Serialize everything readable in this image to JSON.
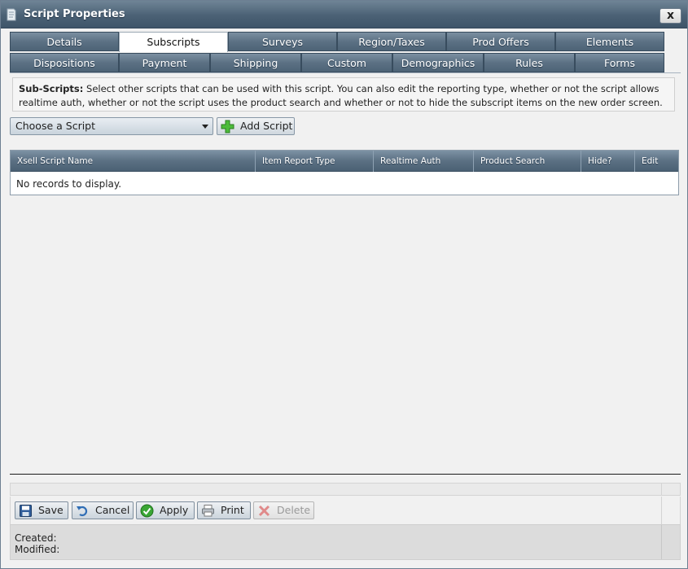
{
  "window": {
    "title": "Script Properties",
    "close_label": "x"
  },
  "tabs_row1": [
    {
      "label": "Details"
    },
    {
      "label": "Subscripts"
    },
    {
      "label": "Surveys"
    },
    {
      "label": "Region/Taxes"
    },
    {
      "label": "Prod Offers"
    },
    {
      "label": "Elements"
    }
  ],
  "tabs_row2": [
    {
      "label": "Dispositions"
    },
    {
      "label": "Payment"
    },
    {
      "label": "Shipping"
    },
    {
      "label": "Custom"
    },
    {
      "label": "Demographics"
    },
    {
      "label": "Rules"
    },
    {
      "label": "Forms"
    }
  ],
  "active_tab": "Subscripts",
  "description": {
    "heading": "Sub-Scripts:",
    "text": " Select other scripts that can be used with this script. You can also edit the reporting type, whether or not the script allows realtime auth, whether or not the script uses the product search and whether or not to hide the subscript items on the new order screen."
  },
  "controls": {
    "choose_script": "Choose a Script",
    "add_script": "Add Script"
  },
  "grid": {
    "columns": [
      "Xsell Script Name",
      "Item Report Type",
      "Realtime Auth",
      "Product Search",
      "Hide?",
      "Edit"
    ],
    "empty_message": "No records to display."
  },
  "buttons": {
    "save": "Save",
    "cancel": "Cancel",
    "apply": "Apply",
    "print": "Print",
    "delete": "Delete"
  },
  "meta": {
    "created_label": "Created:",
    "modified_label": "Modified:"
  },
  "colors": {
    "tab_bg": "#5c7184",
    "title_bg": "#4b6175",
    "window_bg": "#f1f1f1"
  }
}
